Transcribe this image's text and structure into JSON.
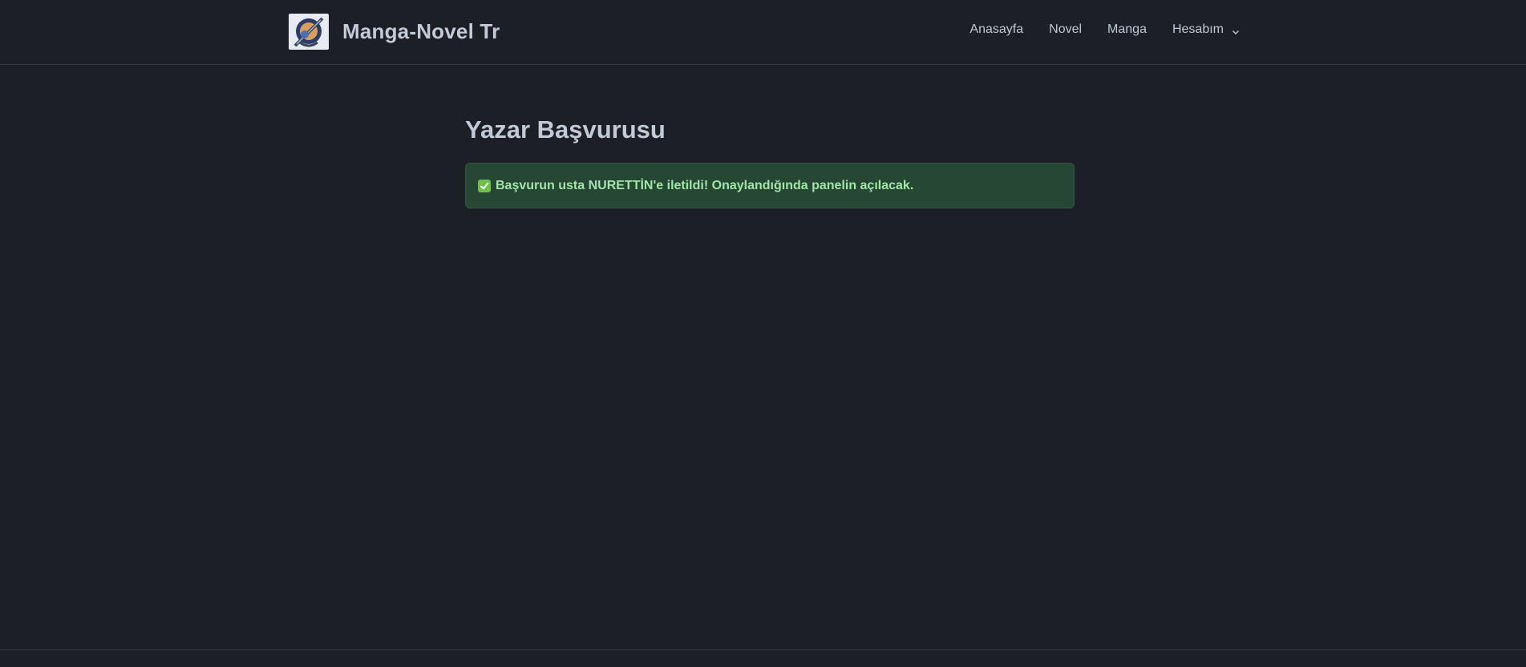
{
  "header": {
    "brand_name": "Manga-Novel Tr",
    "logo_icon": "manga-novel-logo",
    "nav": [
      {
        "label": "Anasayfa"
      },
      {
        "label": "Novel"
      },
      {
        "label": "Manga"
      },
      {
        "label": "Hesabım",
        "icon": "chevron-down-icon"
      }
    ]
  },
  "main": {
    "title": "Yazar Başvurusu",
    "alert": {
      "icon": "check-mark-icon",
      "text": "Başvurun usta NURETTİN'e iletildi! Onaylandığında panelin açılacak."
    }
  },
  "colors": {
    "background": "#1c1f26",
    "alert_bg": "#264733",
    "alert_text": "#a3e4a8",
    "check_icon": "#6fbf4a"
  }
}
